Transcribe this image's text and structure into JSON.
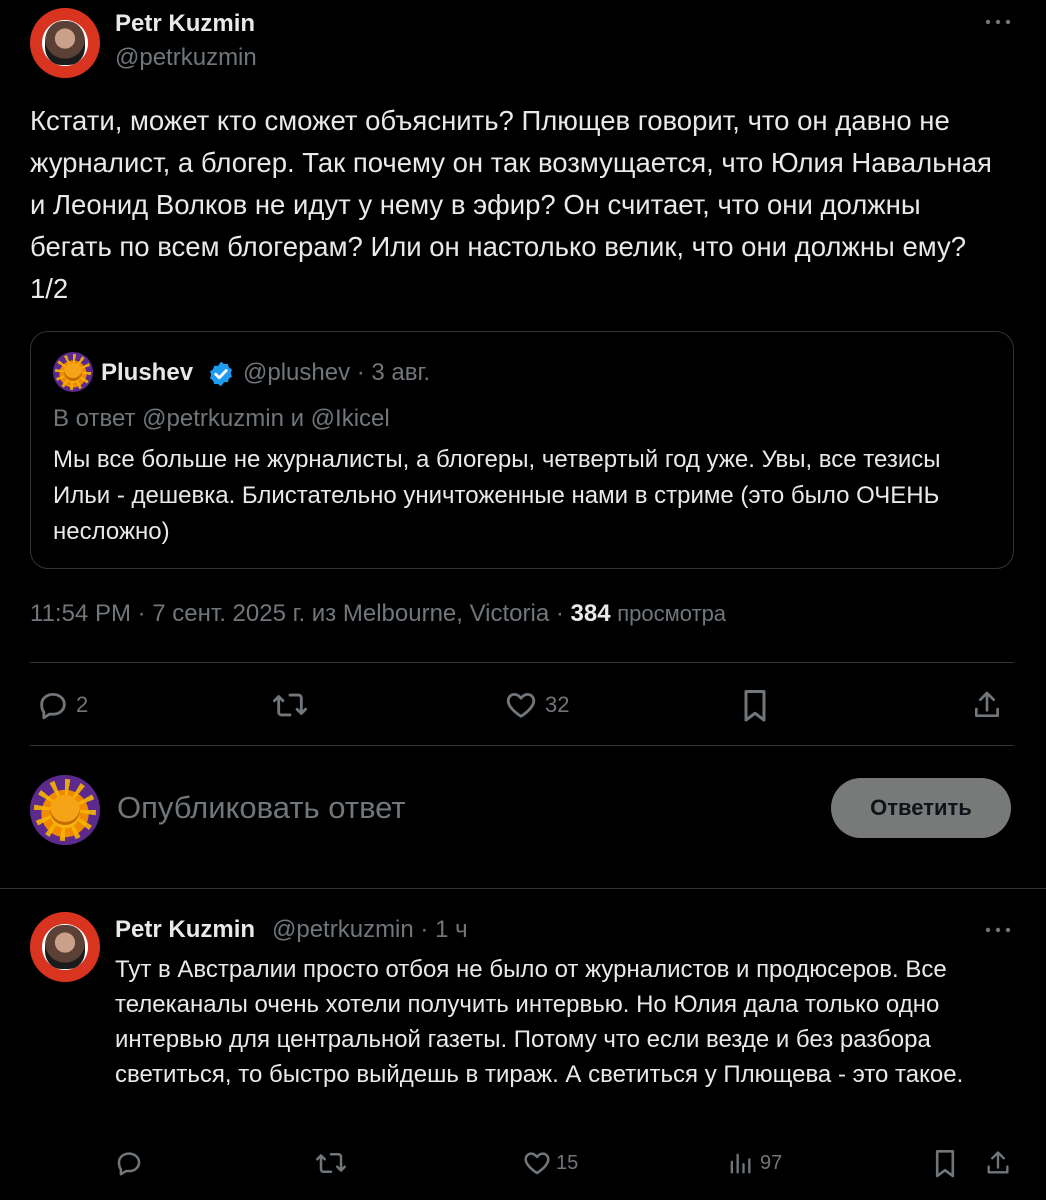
{
  "main_tweet": {
    "author_name": "Petr Kuzmin",
    "author_handle": "@petrkuzmin",
    "more_icon": "more-dots-icon",
    "text": "Кстати, может кто сможет объяснить? Плющев говорит, что он давно не журналист, а блогер. Так почему он так возмущается, что Юлия Навальная и Леонид Волков не идут у нему в эфир? Он считает, что они должны бегать по всем блогерам? Или он настолько велик, что они должны ему?  1/2",
    "quoted": {
      "author_name": "Plushev",
      "verified_icon": "verified-badge-icon",
      "handle_date": "@plushev · 3 авг.",
      "reply_to": "В ответ @petrkuzmin и @Ikicel",
      "text": "Мы все больше не журналисты, а блогеры, четвертый год уже. Увы, все тезисы Ильи - дешевка. Блистательно уничтоженные нами в стриме (это было ОЧЕНЬ несложно)"
    },
    "meta_prefix": "11:54 PM · 7 сент. 2025 г. из Melbourne, Victoria · ",
    "views_count": "384",
    "views_label": "просмотра",
    "actions": {
      "reply_count": "2",
      "repost_count": "",
      "like_count": "32"
    }
  },
  "compose": {
    "placeholder": "Опубликовать ответ",
    "button_label": "Ответить"
  },
  "reply_tweet": {
    "author_name": "Petr Kuzmin",
    "handle_time": "@petrkuzmin · 1 ч",
    "text": "Тут в Австралии просто отбоя не было от журналистов и продюсеров. Все телеканалы очень хотели получить интервью. Но Юлия дала только одно интервью для центральной газеты. Потому что если везде и без разбора светиться, то быстро выйдешь в тираж. А светиться у Плющева - это такое.",
    "actions": {
      "reply_count": "",
      "repost_count": "",
      "like_count": "15",
      "views_count": "97"
    }
  },
  "colors": {
    "background": "#000000",
    "text": "#e7e9ea",
    "muted": "#71767b",
    "border": "#2f3336",
    "verified": "#1d9bf0",
    "button_bg": "#787a7a"
  }
}
